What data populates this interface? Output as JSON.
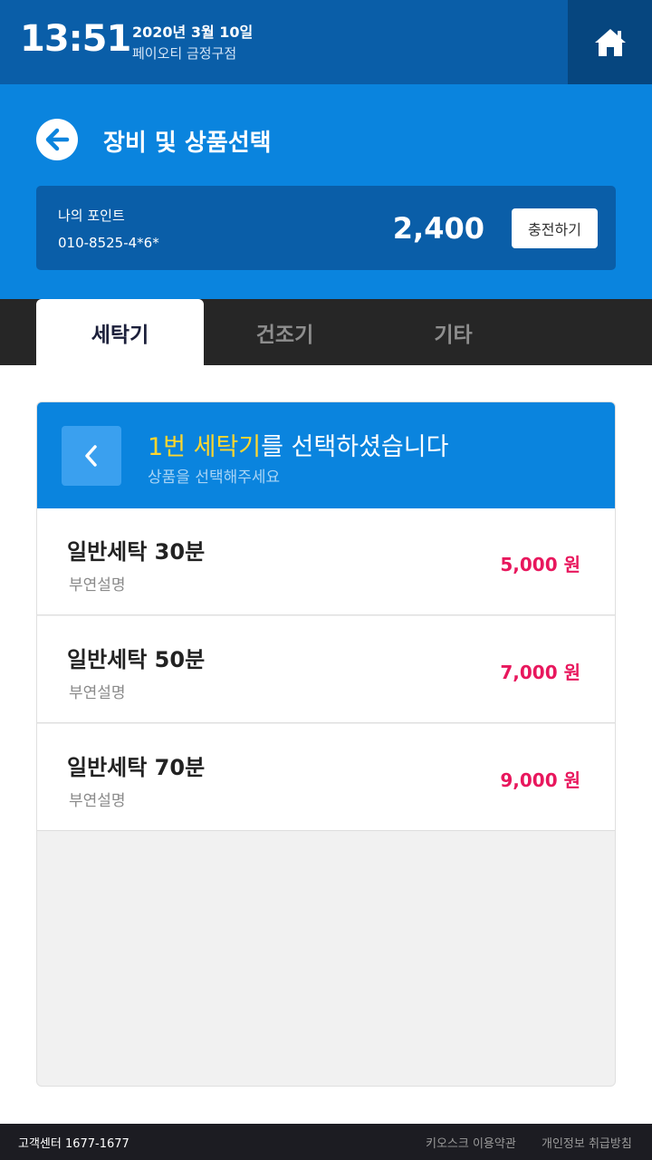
{
  "status": {
    "time": "13:51",
    "date": "2020년 3월 10일",
    "store": "페이오티 금정구점"
  },
  "header": {
    "title": "장비 및 상품선택",
    "point_label": "나의 포인트",
    "phone": "010-8525-4*6*",
    "point_value": "2,400",
    "charge_label": "충전하기"
  },
  "tabs": [
    {
      "label": "세탁기",
      "active": true
    },
    {
      "label": "건조기",
      "active": false
    },
    {
      "label": "기타",
      "active": false
    }
  ],
  "panel": {
    "title_highlight": "1번 세탁기",
    "title_rest": "를 선택하셨습니다",
    "subtitle": "상품을 선택해주세요"
  },
  "products": [
    {
      "name": "일반세탁 30분",
      "desc": "부연설명",
      "price": "5,000 원"
    },
    {
      "name": "일반세탁 50분",
      "desc": "부연설명",
      "price": "7,000 원"
    },
    {
      "name": "일반세탁 70분",
      "desc": "부연설명",
      "price": "9,000 원"
    }
  ],
  "footer": {
    "support": "고객센터 1677-1677",
    "terms": "키오스크 이용약관",
    "privacy": "개인정보 취급방침"
  },
  "colors": {
    "topbar": "#0a5ea8",
    "header": "#0a84de",
    "highlight": "#ffd62e",
    "price": "#e8175d"
  }
}
